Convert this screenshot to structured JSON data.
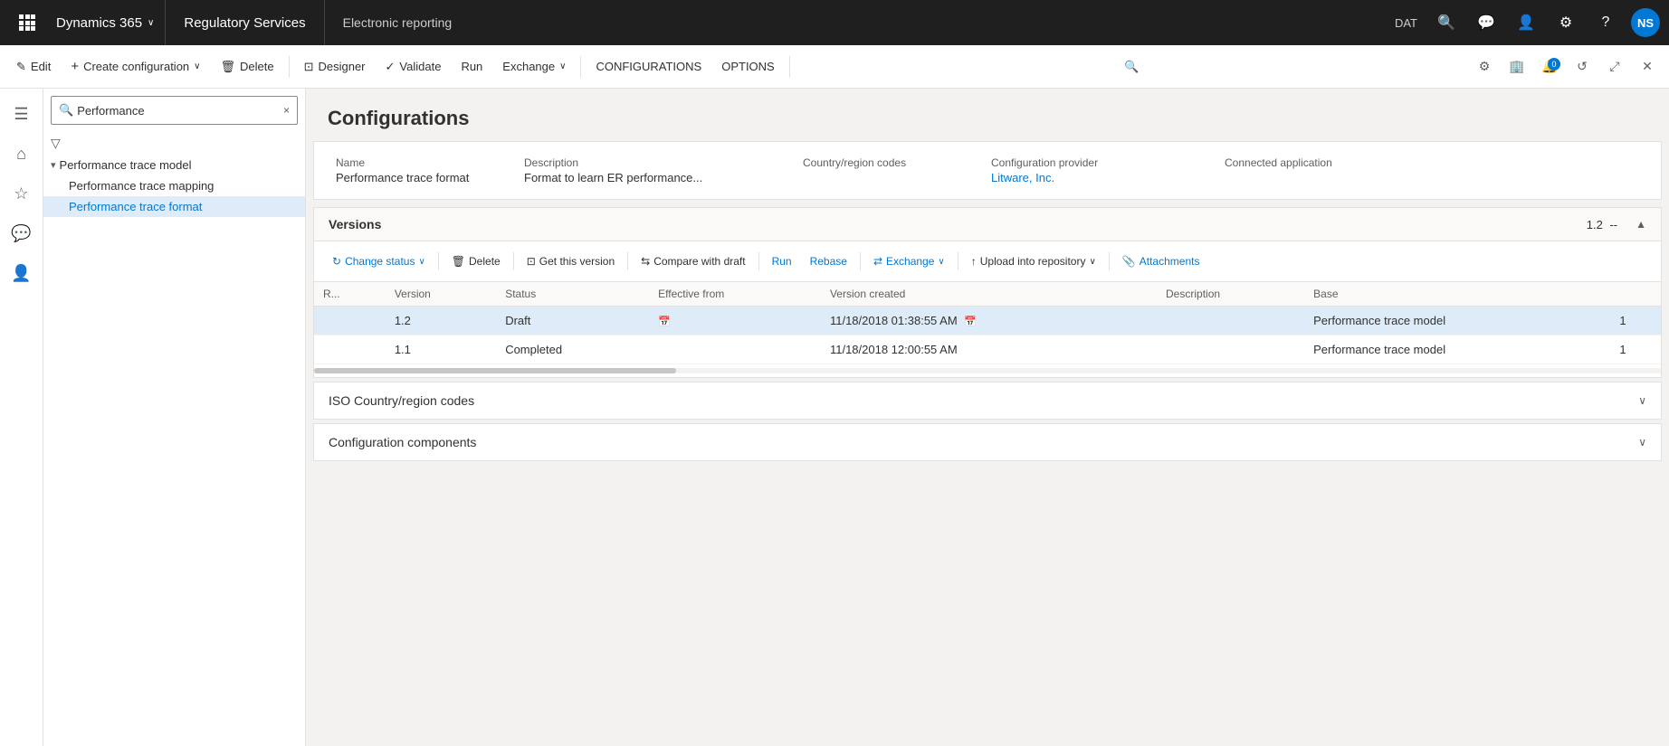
{
  "topnav": {
    "waffle_label": "⊞",
    "d365_label": "Dynamics 365",
    "d365_chevron": "∨",
    "reg_services": "Regulatory Services",
    "er_label": "Electronic reporting",
    "dat_label": "DAT",
    "avatar_initials": "NS"
  },
  "commandbar": {
    "edit_label": "Edit",
    "create_label": "Create configuration",
    "delete_label": "Delete",
    "designer_label": "Designer",
    "validate_label": "Validate",
    "run_label": "Run",
    "exchange_label": "Exchange",
    "configurations_label": "CONFIGURATIONS",
    "options_label": "OPTIONS"
  },
  "sidebar": {
    "search_placeholder": "Performance",
    "search_value": "Performance",
    "items": [
      {
        "id": "perf-trace-model",
        "label": "Performance trace model",
        "level": 0,
        "expanded": true
      },
      {
        "id": "perf-trace-mapping",
        "label": "Performance trace mapping",
        "level": 1
      },
      {
        "id": "perf-trace-format",
        "label": "Performance trace format",
        "level": 1,
        "selected": true
      }
    ]
  },
  "main": {
    "title": "Configurations",
    "detail": {
      "name_label": "Name",
      "name_value": "Performance trace format",
      "description_label": "Description",
      "description_value": "Format to learn ER performance...",
      "country_label": "Country/region codes",
      "country_value": "",
      "provider_label": "Configuration provider",
      "provider_value": "Litware, Inc.",
      "connected_label": "Connected application",
      "connected_value": ""
    },
    "versions": {
      "title": "Versions",
      "version_num": "1.2",
      "version_dashes": "--",
      "toolbar": {
        "change_status": "Change status",
        "delete_label": "Delete",
        "get_version": "Get this version",
        "compare_draft": "Compare with draft",
        "run_label": "Run",
        "rebase_label": "Rebase",
        "exchange_label": "Exchange",
        "upload_label": "Upload into repository",
        "attachments_label": "Attachments"
      },
      "columns": {
        "r": "R...",
        "version": "Version",
        "status": "Status",
        "effective_from": "Effective from",
        "version_created": "Version created",
        "description": "Description",
        "base": "Base"
      },
      "rows": [
        {
          "r": "",
          "version": "1.2",
          "status": "Draft",
          "effective_from": "",
          "version_created": "11/18/2018 01:38:55 AM",
          "description": "",
          "base_link": "Performance trace model",
          "base_num": "1",
          "selected": true
        },
        {
          "r": "",
          "version": "1.1",
          "status": "Completed",
          "effective_from": "",
          "version_created": "11/18/2018 12:00:55 AM",
          "description": "",
          "base_link": "Performance trace model",
          "base_num": "1",
          "selected": false
        }
      ]
    },
    "iso_panel": {
      "title": "ISO Country/region codes"
    },
    "config_components": {
      "title": "Configuration components"
    }
  }
}
